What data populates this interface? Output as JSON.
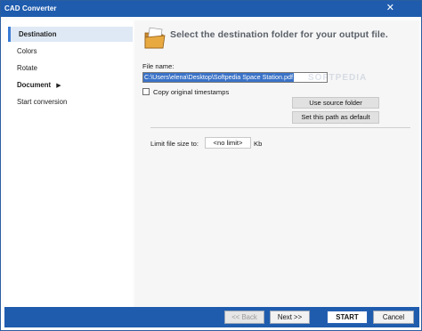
{
  "window": {
    "title": "CAD Converter"
  },
  "sidebar": {
    "items": [
      {
        "label": "Destination",
        "active": true
      },
      {
        "label": "Colors"
      },
      {
        "label": "Rotate"
      },
      {
        "label": "Document",
        "has_submenu": true
      },
      {
        "label": "Start conversion"
      }
    ]
  },
  "main": {
    "heading": "Select the destination folder for your output file.",
    "file_name_label": "File name:",
    "file_name_value": "C:\\Users\\elena\\Desktop\\Softpedia Space Station.pdf",
    "copy_timestamps_label": "Copy original timestamps",
    "copy_timestamps_checked": false,
    "use_source_folder_label": "Use source folder",
    "set_default_path_label": "Set this path as default",
    "limit_label": "Limit file size to:",
    "limit_value": "<no limit>",
    "limit_unit": "Kb",
    "watermark_text": "SOFTPEDIA"
  },
  "footer": {
    "back_label": "<< Back",
    "next_label": "Next >>",
    "start_label": "START",
    "cancel_label": "Cancel"
  },
  "colors": {
    "title_bar": "#1f5cae",
    "selection": "#3a72c7"
  },
  "icons": {
    "close": "close-icon",
    "folder": "folder-icon",
    "submenu_arrow": "chevron-right-icon"
  }
}
